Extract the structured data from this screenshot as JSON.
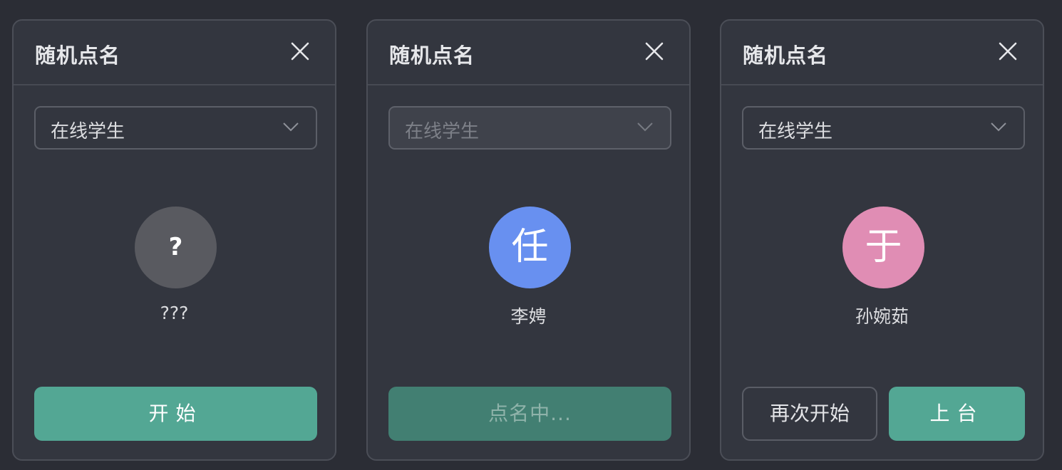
{
  "panels": [
    {
      "title": "随机点名",
      "select_value": "在线学生",
      "select_disabled": false,
      "avatar_text": "?",
      "avatar_color": "#595a60",
      "student_name": "???",
      "buttons": {
        "start": "开始"
      }
    },
    {
      "title": "随机点名",
      "select_value": "在线学生",
      "select_disabled": true,
      "avatar_text": "任",
      "avatar_color": "#6890f0",
      "student_name": "李娉",
      "buttons": {
        "loading": "点名中..."
      }
    },
    {
      "title": "随机点名",
      "select_value": "在线学生",
      "select_disabled": false,
      "avatar_text": "于",
      "avatar_color": "#e08db4",
      "student_name": "孙婉茹",
      "buttons": {
        "restart": "再次开始",
        "on_stage": "上台"
      }
    }
  ],
  "icons": {
    "close": "close-icon",
    "dropdown": "chevron-down-icon"
  },
  "colors": {
    "background": "#2b2d35",
    "panel": "#33363f",
    "accent": "#53a794",
    "accent_loading": "#427f72"
  }
}
